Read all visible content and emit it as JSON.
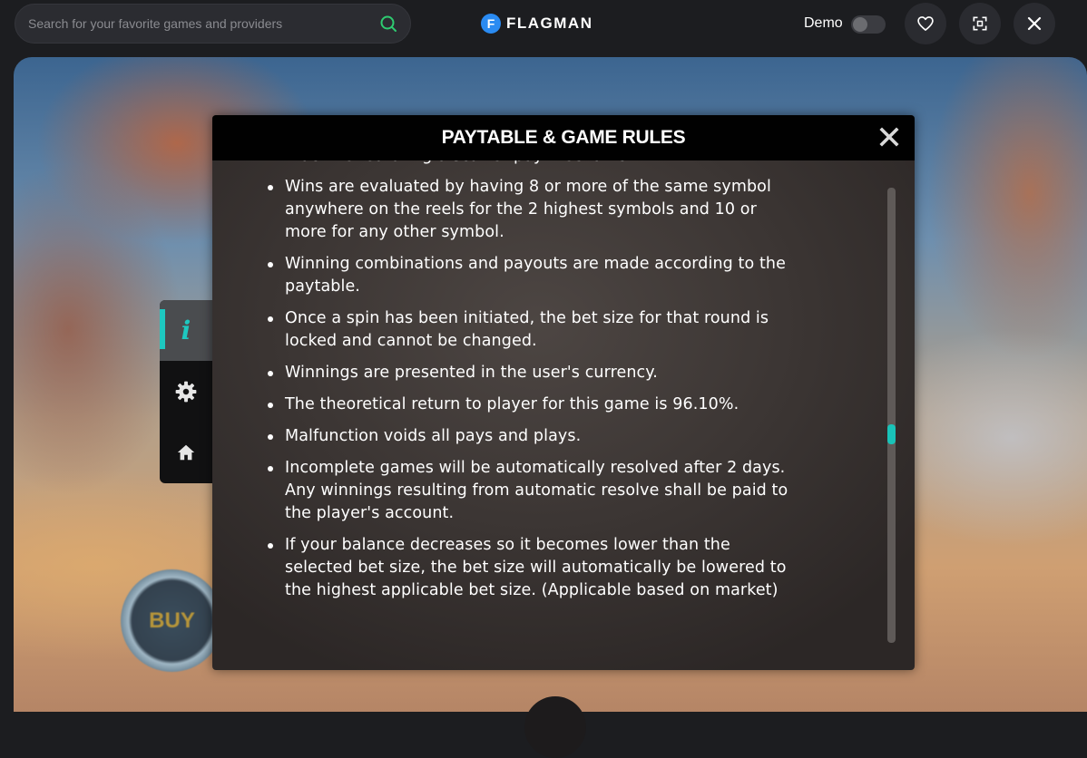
{
  "header": {
    "search_placeholder": "Search for your favorite games and providers",
    "brand_mark": "F",
    "brand_name": "FLAGMAN",
    "demo_label": "Demo",
    "demo_enabled": false,
    "icons": [
      "search-icon",
      "heart-icon",
      "fullscreen-icon",
      "close-icon"
    ]
  },
  "game": {
    "buy_label": "BUY"
  },
  "side_menu": {
    "items": [
      {
        "icon": "info-icon",
        "label": "i",
        "active": true
      },
      {
        "icon": "gear-icon",
        "active": false
      },
      {
        "icon": "home-icon",
        "active": false
      }
    ]
  },
  "modal": {
    "title": "PAYTABLE & GAME RULES",
    "rules": [
      "machine featuring a scatter pay mechanic.",
      "Wins are evaluated by having 8 or more of the same symbol anywhere on the reels for the 2 highest symbols and 10 or more for any other symbol.",
      "Winning combinations and payouts are made according to the paytable.",
      "Once a spin has been initiated, the bet size for that round is locked and cannot be changed.",
      "Winnings are presented in the user's currency.",
      "The theoretical return to player for this game is 96.10%.",
      "Malfunction voids all pays and plays.",
      "Incomplete games will be automatically resolved after 2 days. Any winnings resulting from automatic resolve shall be paid to the player's account.",
      "If your balance decreases so it becomes lower than the selected bet size, the bet size will automatically be lowered to the highest applicable bet size. (Applicable based on market)"
    ]
  },
  "colors": {
    "accent_teal": "#1ec8c0",
    "search_icon": "#2ecc71",
    "brand_blue": "#2a8bf2"
  }
}
